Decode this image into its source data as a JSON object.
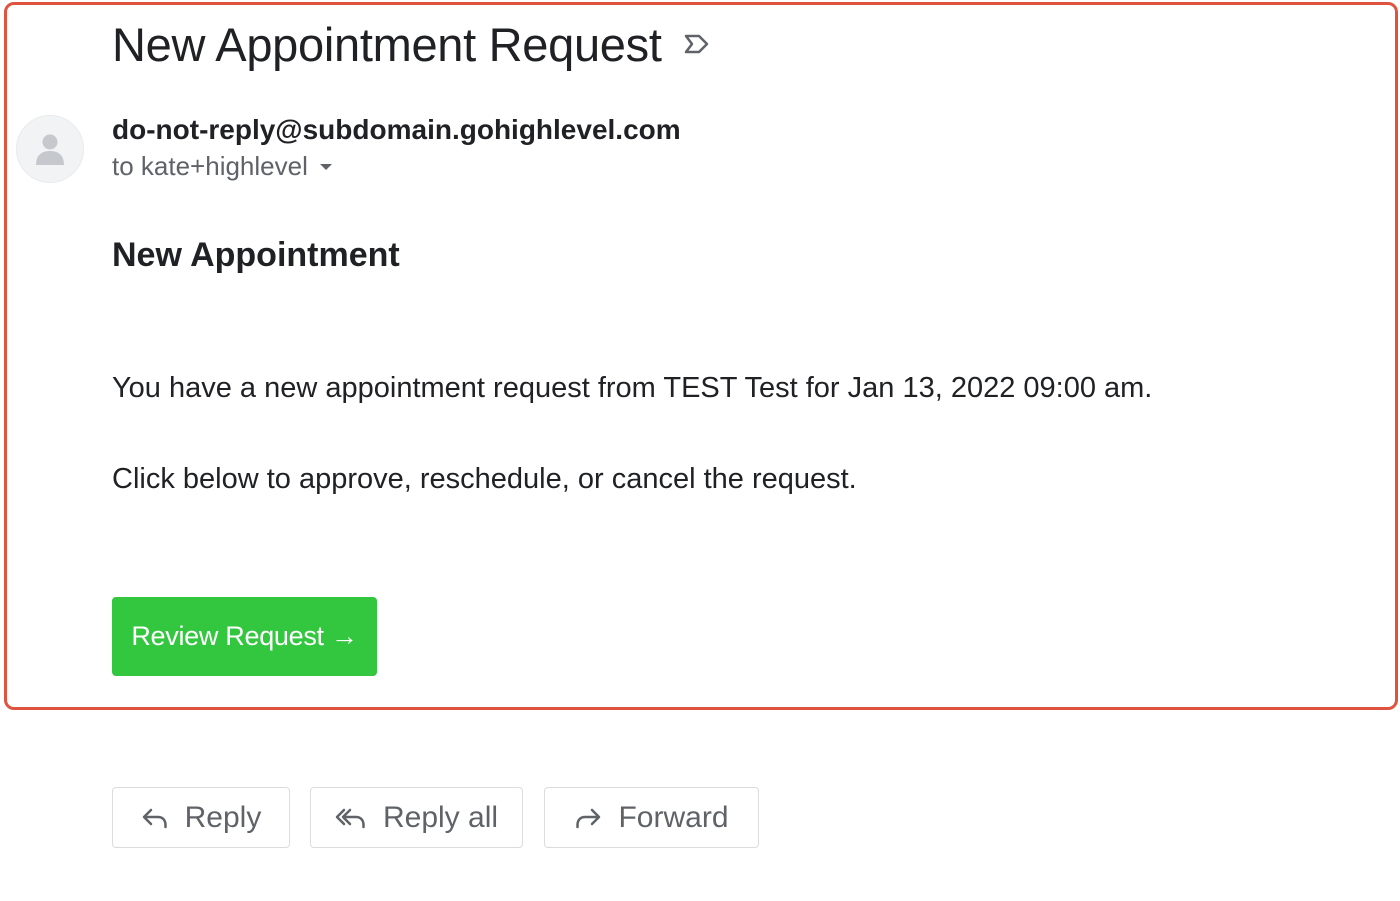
{
  "email": {
    "subject": "New Appointment Request",
    "sender": "do-not-reply@subdomain.gohighlevel.com",
    "recipient": "to kate+highlevel",
    "body": {
      "heading": "New Appointment",
      "paragraph_1": "You have a new appointment request from TEST Test for Jan 13, 2022 09:00 am.",
      "paragraph_2": "Click below to approve, reschedule, or cancel the request.",
      "cta_label": "Review Request →"
    }
  },
  "actions": {
    "reply_label": "Reply",
    "reply_all_label": "Reply all",
    "forward_label": "Forward"
  },
  "icons": {
    "label": "label-outline-icon",
    "avatar": "person-icon",
    "recipient_details": "caret-down-icon",
    "reply": "reply-icon",
    "reply_all": "reply-all-icon",
    "forward": "forward-icon"
  },
  "colors": {
    "highlight_border": "#e0533f",
    "cta_background": "#33c63f",
    "cta_text": "#ffffff",
    "primary_text": "#202124",
    "secondary_text": "#5f6368",
    "button_border": "#dadce0"
  }
}
